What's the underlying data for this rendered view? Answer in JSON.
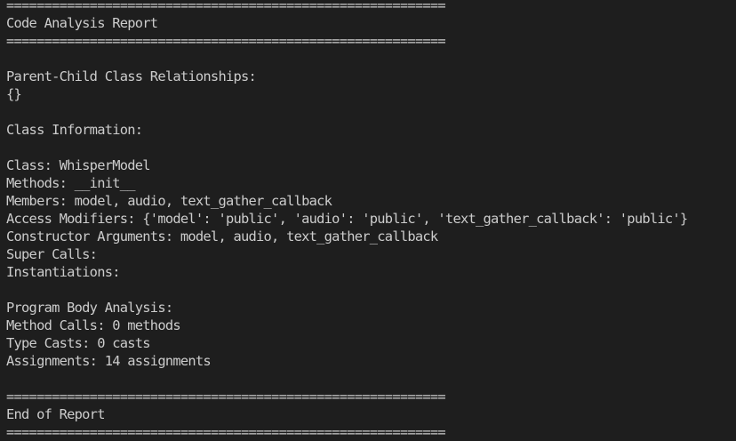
{
  "report": {
    "separator": "==========================================================",
    "title": "Code Analysis Report",
    "relationships_label": "Parent-Child Class Relationships:",
    "relationships_value": "{}",
    "class_info_label": "Class Information:",
    "class_line": "Class: WhisperModel",
    "methods_line": "Methods: __init__",
    "members_line": "Members: model, audio, text_gather_callback",
    "access_line": "Access Modifiers: {'model': 'public', 'audio': 'public', 'text_gather_callback': 'public'}",
    "constructor_line": "Constructor Arguments: model, audio, text_gather_callback",
    "super_calls_line": "Super Calls:",
    "instantiations_line": "Instantiations:",
    "body_analysis_label": "Program Body Analysis:",
    "method_calls_line": "Method Calls: 0 methods",
    "type_casts_line": "Type Casts: 0 casts",
    "assignments_line": "Assignments: 14 assignments",
    "end_label": "End of Report"
  },
  "colors": {
    "background": "#1e1e1e",
    "foreground": "#cccccc"
  }
}
